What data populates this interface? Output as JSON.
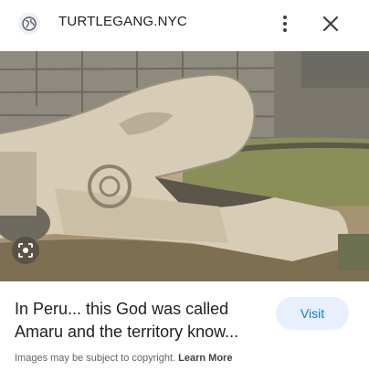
{
  "header": {
    "site_name": "TURTLEGANG.NYC",
    "site_icon": "globe-icon",
    "more_icon": "more-vertical-icon",
    "close_icon": "close-icon"
  },
  "image": {
    "lens_icon": "lens-search-icon"
  },
  "result": {
    "title_line1": "In Peru... this God was called",
    "title_line2": "Amaru and the territory know...",
    "visit_label": "Visit"
  },
  "footer": {
    "copyright_text": "Images may be subject to copyright.",
    "learn_more_label": "Learn More"
  },
  "colors": {
    "accent": "#1a73e8",
    "visit_bg": "#e8f0fe",
    "text_primary": "#202124",
    "text_secondary": "#5f6368"
  }
}
